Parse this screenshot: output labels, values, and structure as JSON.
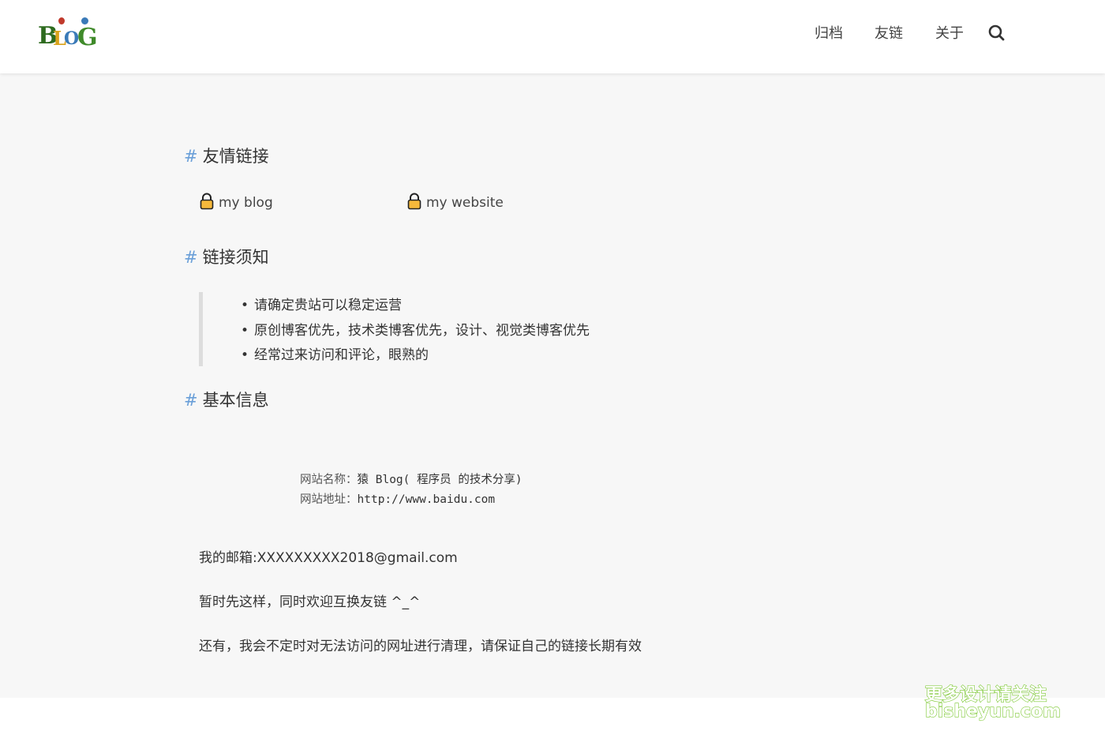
{
  "header": {
    "logo_text": "BLOG",
    "nav": [
      {
        "label": "归档"
      },
      {
        "label": "友链"
      },
      {
        "label": "关于"
      }
    ]
  },
  "sections": {
    "links_title": "友情链接",
    "rules_title": "链接须知",
    "info_title": "基本信息",
    "hash": "#"
  },
  "friend_links": [
    {
      "label": "my blog"
    },
    {
      "label": "my website"
    }
  ],
  "rules": [
    "请确定贵站可以稳定运营",
    "原创博客优先，技术类博客优先，设计、视觉类博客优先",
    "经常过来访问和评论，眼熟的"
  ],
  "site_info": {
    "name_label": "网站名称：",
    "name_value": "猿 Blog( 程序员 的技术分享)",
    "url_label": "网站地址：",
    "url_value": "http://www.baidu.com"
  },
  "paragraphs": [
    "我的邮箱:XXXXXXXXX2018@gmail.com",
    "暂时先这样，同时欢迎互换友链 ^_^",
    "还有，我会不定时对无法访问的网址进行清理，请保证自己的链接长期有效"
  ],
  "watermark": {
    "line1": "更多设计请关注",
    "line2": "bisheyun.com"
  },
  "icons": {
    "logo": "blog-logo-icon",
    "search": "search-icon",
    "lock": "lock-icon"
  },
  "colors": {
    "accent_hash": "#6a9fd8",
    "lock_fill": "#f6b93b",
    "watermark": "#7cc832"
  }
}
